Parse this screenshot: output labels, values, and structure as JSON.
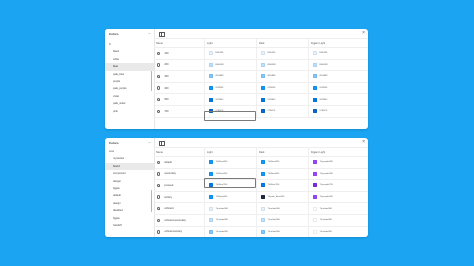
{
  "panel1": {
    "sidebar": {
      "title": "Colors",
      "menu": "···",
      "items": [
        {
          "label": "S",
          "root": true,
          "selected": false
        },
        {
          "label": "black",
          "root": false,
          "selected": false
        },
        {
          "label": "white",
          "root": false,
          "selected": false
        },
        {
          "label": "blue",
          "root": false,
          "selected": true
        },
        {
          "label": "pale_blue",
          "root": false,
          "selected": false
        },
        {
          "label": "purple",
          "root": false,
          "selected": false
        },
        {
          "label": "pale_purple",
          "root": false,
          "selected": false
        },
        {
          "label": "violet",
          "root": false,
          "selected": false
        },
        {
          "label": "pale_violet",
          "root": false,
          "selected": false
        },
        {
          "label": "pink",
          "root": false,
          "selected": false
        }
      ]
    },
    "toolbar": {
      "close": "×"
    },
    "headers": {
      "name": "Name",
      "light": "Light",
      "dark": "Dark",
      "figma": "Figjam Light"
    },
    "rows": [
      {
        "name": "100",
        "light": {
          "color": "#e5f4ff",
          "value": "E5F4FF"
        },
        "dark": {
          "color": "#e5f4ff",
          "value": "E5F4FF"
        },
        "figma": {
          "color": "#e5f4ff",
          "value": "E5F4FF"
        }
      },
      {
        "name": "200",
        "light": {
          "color": "#bde3ff",
          "value": "BDE3FF"
        },
        "dark": {
          "color": "#bde3ff",
          "value": "BDE3FF"
        },
        "figma": {
          "color": "#bde3ff",
          "value": "BDE3FF"
        }
      },
      {
        "name": "300",
        "light": {
          "color": "#80caff",
          "value": "80CAFF"
        },
        "dark": {
          "color": "#80caff",
          "value": "80CAFF"
        },
        "figma": {
          "color": "#80caff",
          "value": "80CAFF"
        }
      },
      {
        "name": "400",
        "light": {
          "color": "#0d99ff",
          "value": "0D99FF"
        },
        "dark": {
          "color": "#0d99ff",
          "value": "0D99FF"
        },
        "figma": {
          "color": "#0d99ff",
          "value": "0D99FF"
        }
      },
      {
        "name": "500",
        "light": {
          "color": "#007be5",
          "value": "007BE5"
        },
        "dark": {
          "color": "#007be5",
          "value": "007BE5"
        },
        "figma": {
          "color": "#007be5",
          "value": "007BE5"
        }
      },
      {
        "name": "700",
        "light": {
          "color": "#0768cf",
          "value": "0768CF"
        },
        "dark": {
          "color": "#0768cf",
          "value": "0768CF"
        },
        "figma": {
          "color": "#0768cf",
          "value": "0768CF"
        }
      }
    ]
  },
  "panel2": {
    "sidebar": {
      "title": "Colors",
      "menu": "···",
      "items": [
        {
          "label": "core",
          "root": true,
          "selected": false
        },
        {
          "label": "mysteries",
          "root": false,
          "selected": false
        },
        {
          "label": "brand",
          "root": false,
          "selected": true
        },
        {
          "label": "component",
          "root": false,
          "selected": false
        },
        {
          "label": "danger",
          "root": false,
          "selected": false
        },
        {
          "label": "figjam",
          "root": false,
          "selected": false
        },
        {
          "label": "default",
          "root": false,
          "selected": false
        },
        {
          "label": "design",
          "root": false,
          "selected": false
        },
        {
          "label": "disabled",
          "root": false,
          "selected": false
        },
        {
          "label": "figjam",
          "root": false,
          "selected": false
        },
        {
          "label": "handoff",
          "root": false,
          "selected": false
        }
      ]
    },
    "toolbar": {
      "close": "×"
    },
    "headers": {
      "name": "Name",
      "light": "Light",
      "dark": "Dark",
      "figma": "Figjam Light"
    },
    "rows": [
      {
        "name": "default",
        "light": {
          "color": "#0d99ff",
          "value": "Tk.Blue/400"
        },
        "dark": {
          "color": "#0d99ff",
          "value": "Tk.Blue/400"
        },
        "figma": {
          "color": "#9747ff",
          "value": "Tk.purple/400"
        }
      },
      {
        "name": "secondary",
        "light": {
          "color": "#0d99ff",
          "value": "Tk.Blue/400"
        },
        "dark": {
          "color": "#0d99ff",
          "value": "Tk.Blue/400"
        },
        "figma": {
          "color": "#9747ff",
          "value": "Tk.purple/400"
        }
      },
      {
        "name": "pressed",
        "light": {
          "color": "#007be5",
          "value": "Tk.Blue/700"
        },
        "dark": {
          "color": "#007be5",
          "value": "Tk.Blue/700"
        },
        "figma": {
          "color": "#7b2ee0",
          "value": "Tk.purple/700"
        }
      },
      {
        "name": "tertiary",
        "light": {
          "color": "#0d99ff",
          "value": "Tk.Blue/400"
        },
        "dark": {
          "color": "#1f2a44",
          "value": "Tk.pale_blue/400"
        },
        "figma": {
          "color": "#9747ff",
          "value": "Tk.purple/400"
        }
      },
      {
        "name": "onbrand",
        "light": {
          "color": "#e5f4ff",
          "value": "Tk.white/400"
        },
        "dark": {
          "color": "#e5f4ff",
          "value": "Tk.white/400"
        },
        "figma": {
          "color": "#ffffff",
          "value": "Tk.white/400"
        }
      },
      {
        "name": "onbrand-secondary",
        "light": {
          "color": "#bde3ff",
          "value": "Tk.white/400"
        },
        "dark": {
          "color": "#bde3ff",
          "value": "Tk.white/400"
        },
        "figma": {
          "color": "#ffffff",
          "value": "Tk.white/400"
        }
      },
      {
        "name": "onbrand-tertiary",
        "light": {
          "color": "#80caff",
          "value": "Tk.white/400"
        },
        "dark": {
          "color": "#80caff",
          "value": "Tk.white/400"
        },
        "figma": {
          "color": "#ffffff",
          "value": "Tk.white/400"
        }
      }
    ]
  }
}
